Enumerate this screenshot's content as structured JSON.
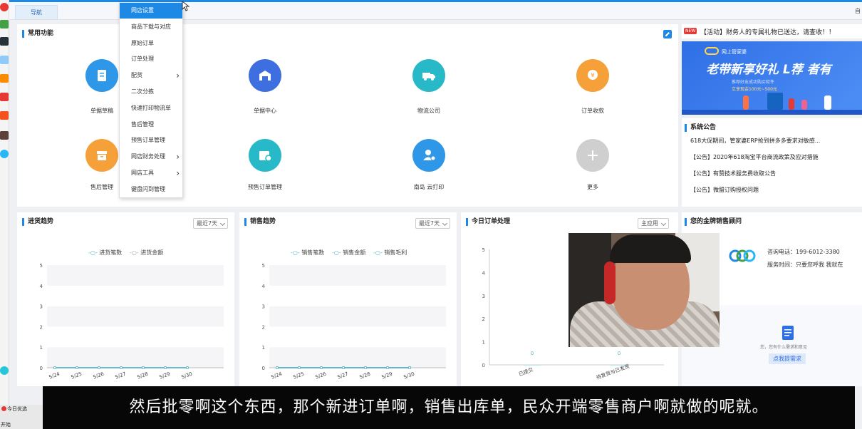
{
  "tabs": {
    "home": "导航",
    "right": "自"
  },
  "dropdown_menu": {
    "items": [
      {
        "label": "网店设置",
        "selected": true,
        "submenu": false
      },
      {
        "label": "商品下载与对应",
        "selected": false,
        "submenu": false
      },
      {
        "label": "原始订单",
        "selected": false,
        "submenu": false
      },
      {
        "label": "订单处理",
        "selected": false,
        "submenu": false
      },
      {
        "label": "配货",
        "selected": false,
        "submenu": true
      },
      {
        "label": "二次分拣",
        "selected": false,
        "submenu": false
      },
      {
        "label": "快速打印物流单",
        "selected": false,
        "submenu": false
      },
      {
        "label": "售后管理",
        "selected": false,
        "submenu": false
      },
      {
        "label": "预售订单管理",
        "selected": false,
        "submenu": false
      },
      {
        "label": "网店财务处理",
        "selected": false,
        "submenu": true
      },
      {
        "label": "网店工具",
        "selected": false,
        "submenu": true
      },
      {
        "label": "键盘闪到管理",
        "selected": false,
        "submenu": false
      }
    ]
  },
  "common_functions": {
    "title": "常用功能",
    "items": [
      {
        "label": "单据草稿",
        "color": "#2e97e8",
        "icon": "document-icon"
      },
      {
        "label": "单据中心",
        "color": "#3d6fe0",
        "icon": "warehouse-icon"
      },
      {
        "label": "物流公司",
        "color": "#27b9c7",
        "icon": "truck-icon"
      },
      {
        "label": "订单收款",
        "color": "#f6a03a",
        "icon": "payment-icon"
      },
      {
        "label": "售后管理",
        "color": "#f6a03a",
        "icon": "box-icon"
      },
      {
        "label": "预售订单管理",
        "color": "#27b9c7",
        "icon": "calendar-icon"
      },
      {
        "label": "南岛 云打印",
        "color": "#2e97e8",
        "icon": "user-print-icon"
      },
      {
        "label": "更多",
        "color": "#cfcfcf",
        "icon": "plus-icon"
      }
    ]
  },
  "notice": {
    "badge": "NEW",
    "text": "【活动】财务人的专属礼物已送达，请查收！！"
  },
  "banner": {
    "brand": "网上管家婆",
    "headline": "老带新享好礼 L荐 者有",
    "sub": "推荐好友成功购买软件",
    "sub2": "立享现金100元~500元"
  },
  "announcements": {
    "title": "系统公告",
    "items": [
      "618大促期间，管家婆ERP抢到拼多多要求对敏感...",
      "【公告】2020年618淘宝平台商流政策及应对措施",
      "【公告】有赞技术服务费收取公告",
      "【公告】微盟订购授权问题"
    ]
  },
  "purchase_trend": {
    "title": "进货趋势",
    "period": "最近7天",
    "chart_data": {
      "type": "line",
      "categories": [
        "5/24",
        "5/25",
        "5/26",
        "5/27",
        "5/28",
        "5/29",
        "5/30"
      ],
      "series": [
        {
          "name": "进货笔数",
          "values": [
            0,
            0,
            0,
            0,
            0,
            0,
            0
          ]
        },
        {
          "name": "进货金额",
          "values": [
            0,
            0,
            0,
            0,
            0,
            0,
            0
          ]
        }
      ],
      "ylim": [
        0,
        5
      ],
      "yticks": [
        "0",
        "1",
        "2",
        "3",
        "4",
        "5"
      ]
    }
  },
  "sales_trend": {
    "title": "销售趋势",
    "period": "最近7天",
    "chart_data": {
      "type": "line",
      "categories": [
        "5/24",
        "5/25",
        "5/26",
        "5/27",
        "5/28",
        "5/29",
        "5/30"
      ],
      "series": [
        {
          "name": "销售笔数",
          "values": [
            0,
            0,
            0,
            0,
            0,
            0,
            0
          ]
        },
        {
          "name": "销售金额",
          "values": [
            0,
            0,
            0,
            0,
            0,
            0,
            0
          ]
        },
        {
          "name": "销售毛利",
          "values": [
            0,
            0,
            0,
            0,
            0,
            0,
            0
          ]
        }
      ],
      "ylim": [
        0,
        5
      ],
      "yticks": [
        "0",
        "1",
        "2",
        "3",
        "4",
        "5"
      ]
    }
  },
  "today_orders": {
    "title": "今日订单处理",
    "period": "主应用",
    "chart_data": {
      "type": "bar",
      "categories": [
        "已提交",
        "待发货与已发货"
      ],
      "values": [
        0,
        0
      ],
      "ylim": [
        0,
        5
      ],
      "yticks": [
        "0",
        "1",
        "2",
        "3",
        "4",
        "5"
      ]
    }
  },
  "consultant": {
    "title": "您的金牌销售顾问",
    "phone_label": "咨询电话：199-6012-3380",
    "hours_label": "服务时间：只要您呼我 我就在",
    "feedback_hint": "您，您有什么需求和意见",
    "feedback_button": "点我提需求"
  },
  "subtitle": "然后批零啊这个东西，那个新进订单啊，销售出库单，民众开端零售商户啊就做的呢就。",
  "taskbar": {
    "item": "今日优选",
    "start": "开始"
  }
}
